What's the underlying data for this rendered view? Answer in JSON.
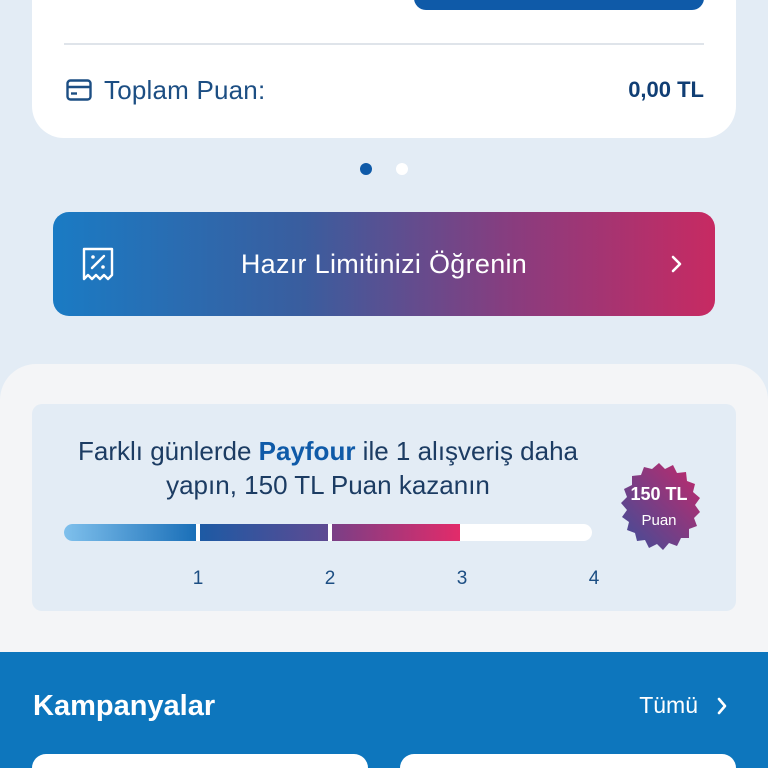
{
  "points_card": {
    "label": "Toplam Puan:",
    "value": "0,00 TL",
    "icon": "wallet-card-icon"
  },
  "pager": {
    "count": 2,
    "active_index": 0
  },
  "limit_banner": {
    "label": "Hazır Limitinizi Öğrenin",
    "icon": "limit-discount-icon",
    "chevron": "chevron-right-icon"
  },
  "progress": {
    "text_before": "Farklı günlerde ",
    "brand": "Payfour",
    "text_after": " ile 1 alışveriş daha yapın, 150 TL Puan kazanın",
    "completed_steps": 3,
    "total_steps": 4,
    "steps": [
      "1",
      "2",
      "3",
      "4"
    ],
    "reward": {
      "amount": "150 TL",
      "unit": "Puan"
    }
  },
  "campaigns": {
    "title": "Kampanyalar",
    "see_all": "Tümü"
  },
  "colors": {
    "primary": "#0f5aa8",
    "campaigns_bg": "#0d76bd",
    "page_bg": "#e3ecf5",
    "accent_pink": "#c72a62"
  }
}
